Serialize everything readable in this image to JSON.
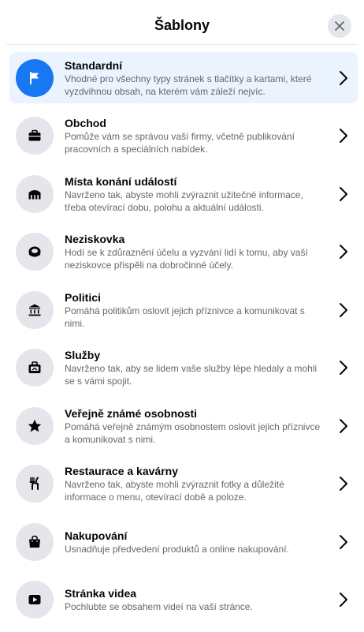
{
  "dialog": {
    "title": "Šablony",
    "close_label": "Zavřít"
  },
  "templates": [
    {
      "title": "Standardní",
      "desc": "Vhodné pro všechny typy stránek s tlačítky a kartami, které vyzdvihnou obsah, na kterém vám záleží nejvíc.",
      "icon": "flag-icon",
      "selected": true
    },
    {
      "title": "Obchod",
      "desc": "Pomůže vám se správou vaší firmy, včetně publikování pracovních a speciálních nabídek.",
      "icon": "briefcase-icon"
    },
    {
      "title": "Místa konání událostí",
      "desc": "Navrženo tak, abyste mohli zvýraznit užitečné informace, třeba otevírací dobu, polohu a aktuální události.",
      "icon": "venue-icon"
    },
    {
      "title": "Neziskovka",
      "desc": "Hodí se k zdůraznění účelu a vyzvání lidí k tomu, aby vaší neziskovce přispěli na dobročinné účely.",
      "icon": "donation-icon"
    },
    {
      "title": "Politici",
      "desc": "Pomáhá politikům oslovit jejich příznivce a komunikovat s nimi.",
      "icon": "government-icon"
    },
    {
      "title": "Služby",
      "desc": "Navrženo tak, aby se lidem vaše služby lépe hledaly a mohli se s vámi spojit.",
      "icon": "toolbox-icon"
    },
    {
      "title": "Veřejně známé osobnosti",
      "desc": "Pomáhá veřejně známým osobnostem oslovit jejich příznivce a komunikovat s nimi.",
      "icon": "star-icon"
    },
    {
      "title": "Restaurace a kavárny",
      "desc": "Navrženo tak, abyste mohli zvýraznit fotky a důležité informace o menu, otevírací době a poloze.",
      "icon": "cutlery-icon"
    },
    {
      "title": "Nakupování",
      "desc": "Usnadňuje předvedení produktů a online nakupování.",
      "icon": "shopping-bag-icon"
    },
    {
      "title": "Stránka videa",
      "desc": "Pochlubte se obsahem videí na vaší stránce.",
      "icon": "video-icon"
    }
  ],
  "colors": {
    "accent": "#1877f2",
    "selected_bg": "#ebf3ff",
    "icon_bg": "#e4e6eb"
  }
}
